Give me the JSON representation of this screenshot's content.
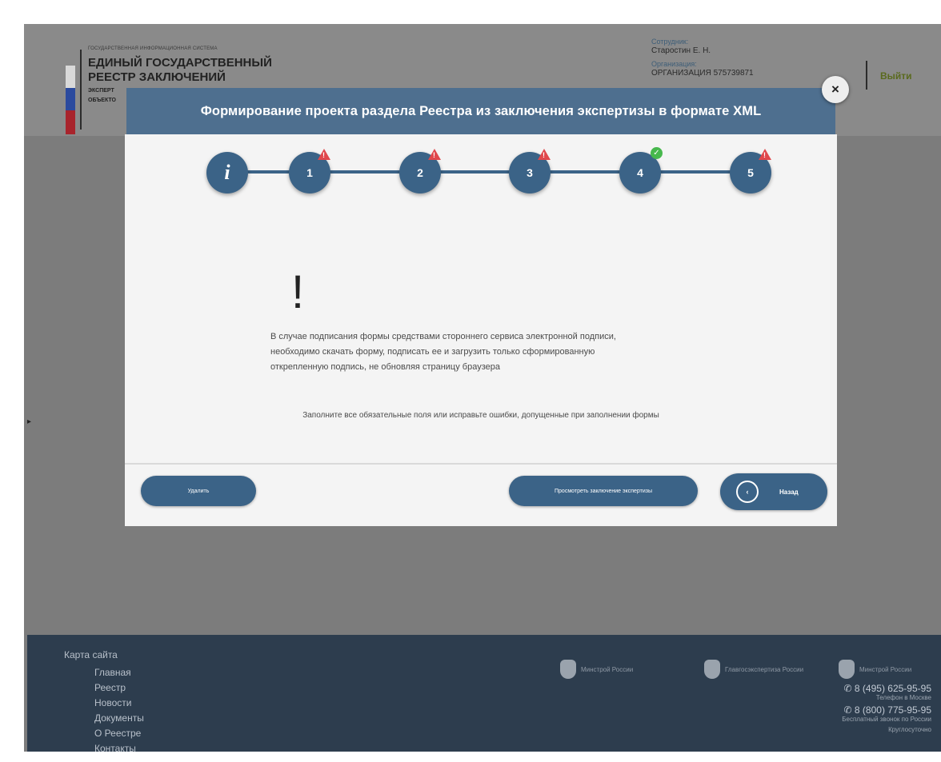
{
  "header": {
    "logo_subtitle": "ГОСУДАРСТВЕННАЯ ИНФОРМАЦИОННАЯ СИСТЕМА",
    "logo_title_line1": "ЕДИНЫЙ ГОСУДАРСТВЕННЫЙ",
    "logo_title_line2": "РЕЕСТР ЗАКЛЮЧЕНИЙ",
    "logo_line3": "ЭКСПЕРТ",
    "logo_line4": "ОБЪЕКТО",
    "employee_label": "Сотрудник:",
    "employee_name": "Старостин Е. Н.",
    "org_label": "Организация:",
    "org_value": "ОРГАНИЗАЦИЯ 575739871",
    "logout": "Выйти"
  },
  "modal": {
    "title": "Формирование проекта раздела Реестра из заключения экспертизы в формате XML",
    "close_glyph": "×",
    "steps": [
      {
        "label": "i",
        "status": "info"
      },
      {
        "label": "1",
        "status": "warning"
      },
      {
        "label": "2",
        "status": "warning"
      },
      {
        "label": "3",
        "status": "warning"
      },
      {
        "label": "4",
        "status": "ok"
      },
      {
        "label": "5",
        "status": "warning"
      }
    ],
    "exclamation": "!",
    "note": "В случае подписания формы средствами стороннего сервиса электронной подписи, необходимо скачать форму, подписать ее и загрузить только сформированную открепленную подпись, не обновляя страницу браузера",
    "hint": "Заполните все обязательные поля или исправьте ошибки, допущенные при заполнении формы",
    "delete_button": "Удалить",
    "view_button": "Просмотреть заключение экспертизы",
    "back_button": "Назад",
    "back_icon": "‹"
  },
  "footer": {
    "sitemap_title": "Карта сайта",
    "links": [
      "Главная",
      "Реестр",
      "Новости",
      "Документы",
      "О Реестре",
      "Контакты"
    ],
    "partner1": "Минстрой России",
    "partner2": "Главгосэкспертиза России",
    "partner3": "Минстрой России",
    "phone1": "8 (495) 625-95-95",
    "phone1_note": "Телефон в Москве",
    "phone2": "8 (800) 775-95-95",
    "phone2_note": "Бесплатный звонок по России",
    "phone3_note": "Круглосуточно"
  },
  "colors": {
    "modal_header": "#4e6f8f",
    "step": "#3b6387",
    "warning": "#e0474c",
    "ok": "#47b84d",
    "footer": "#2d3d4e"
  }
}
